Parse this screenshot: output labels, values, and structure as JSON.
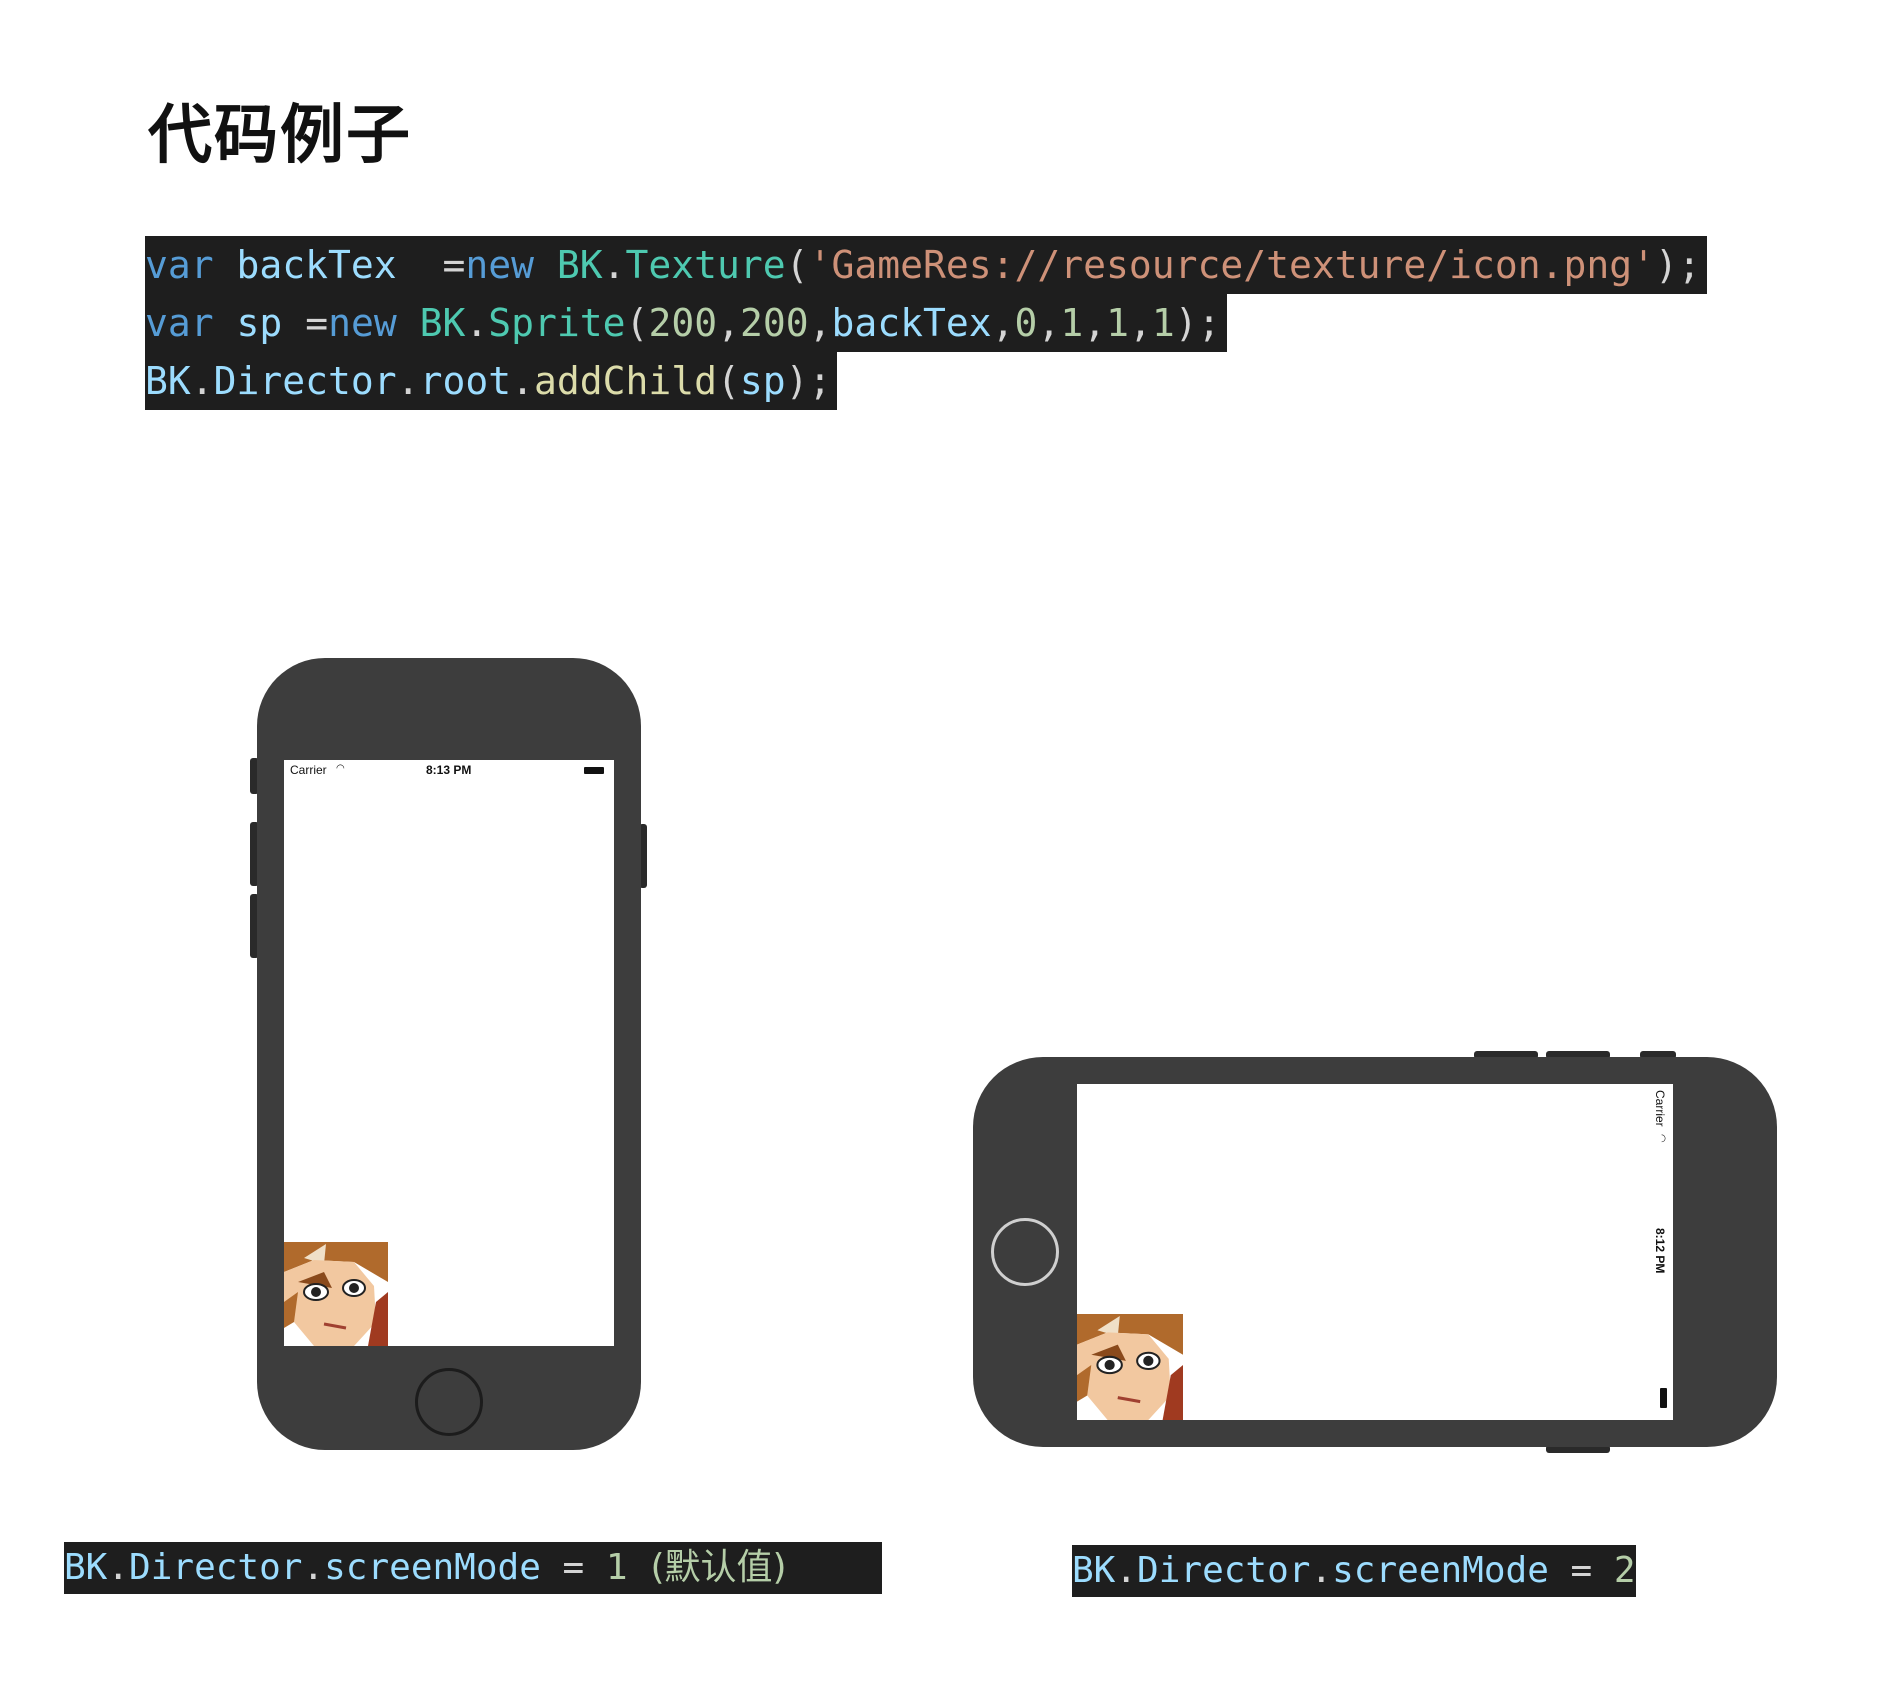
{
  "title": "代码例子",
  "code": {
    "line1": {
      "kw": "var",
      "varname": "backTex",
      "assign": "  =",
      "new": "new",
      "ns": "BK",
      "dot": ".",
      "cls": "Texture",
      "open": "(",
      "str": "'GameRes://resource/texture/icon.png'",
      "close": ");"
    },
    "line2": {
      "kw": "var",
      "varname": "sp",
      "assign": "=",
      "new": "new",
      "ns": "BK",
      "dot": ".",
      "cls": "Sprite",
      "open": "(",
      "n1": "200",
      "c1": ",",
      "n2": "200",
      "c2": ",",
      "arg": "backTex",
      "c3": ",",
      "n3": "0",
      "c4": ",",
      "n4": "1",
      "c5": ",",
      "n5": "1",
      "c6": ",",
      "n6": "1",
      "close": ");"
    },
    "line3": {
      "ns": "BK",
      "dot1": ".",
      "dir": "Director",
      "dot2": ".",
      "root": "root",
      "dot3": ".",
      "fn": "addChild",
      "open": "(",
      "arg": "sp",
      "close": ");"
    }
  },
  "portrait": {
    "carrier": "Carrier",
    "time": "8:13 PM"
  },
  "landscape": {
    "carrier": "Carrier",
    "time": "8:12 PM"
  },
  "captions": {
    "left": {
      "ns": "BK",
      "dot1": ".",
      "dir": "Director",
      "dot2": ".",
      "prop": "screenMode",
      "eq": " = ",
      "val": "1",
      "note": "  (默认值)"
    },
    "right": {
      "ns": "BK",
      "dot1": ".",
      "dir": "Director",
      "dot2": ".",
      "prop": "screenMode",
      "eq": " = ",
      "val": "2"
    }
  },
  "colors": {
    "code_bg": "#1e1e1e",
    "keyword": "#569cd6",
    "variable": "#9cdcfe",
    "class": "#4ec9b0",
    "string": "#ce9178",
    "number": "#b5cea8",
    "function": "#dcdcaa",
    "phone_body": "#3d3d3d"
  }
}
